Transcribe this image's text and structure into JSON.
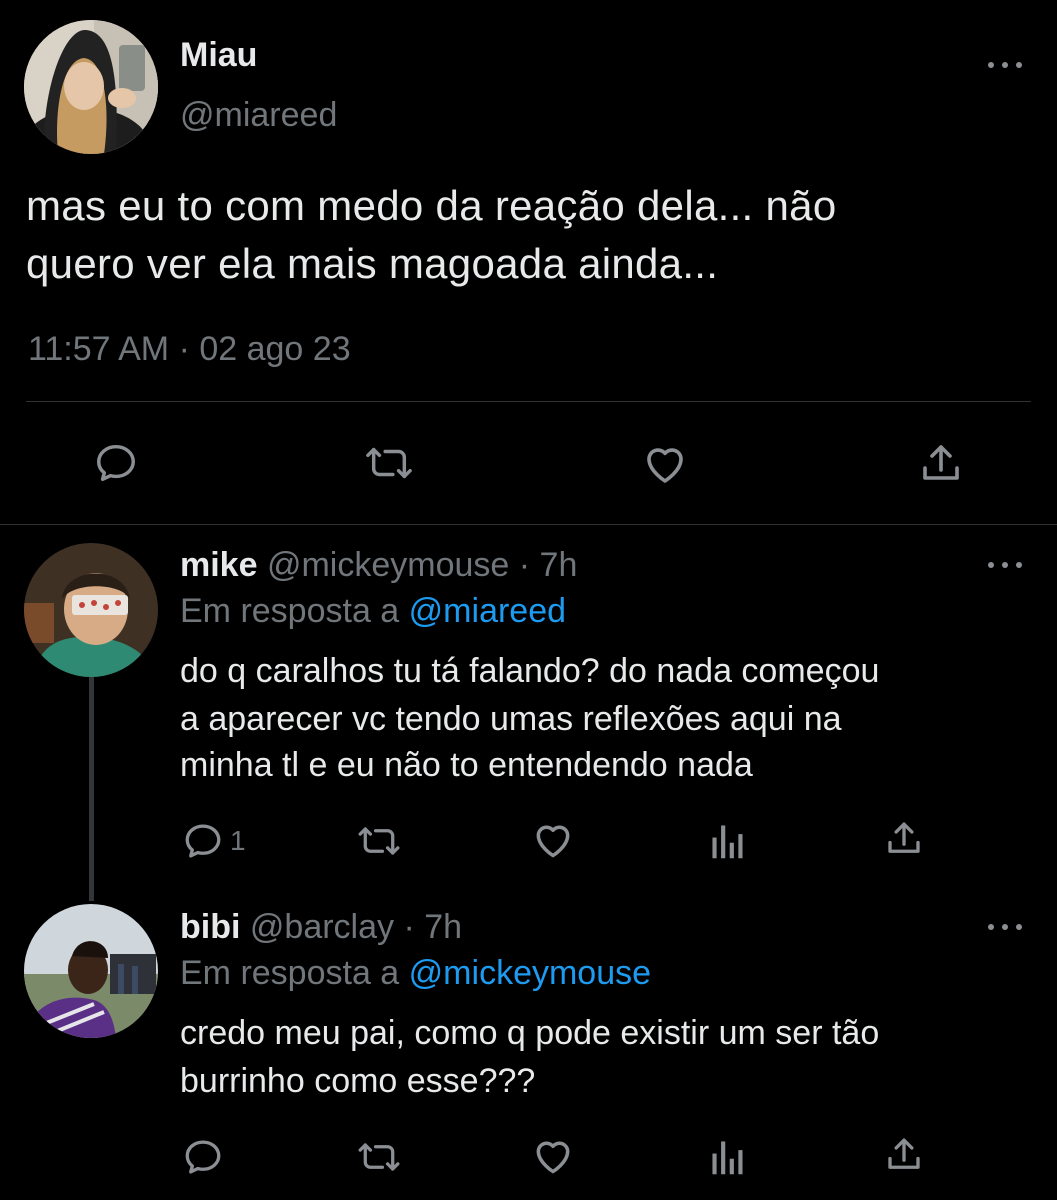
{
  "main_tweet": {
    "display_name": "Miau",
    "handle": "@miareed",
    "text_line1": "mas eu to com medo da reação dela... não",
    "text_line2": "quero ver ela mais magoada ainda...",
    "timestamp": "11:57 AM · 02 ago 23"
  },
  "replies": [
    {
      "display_name": "mike",
      "handle": "@mickeymouse",
      "time": "· 7h",
      "reply_prefix": "Em resposta a",
      "reply_to": "@miareed",
      "text_line1": "do q caralhos tu tá falando? do nada começou",
      "text_line2": "a aparecer vc tendo umas reflexões aqui na",
      "text_line3": "minha tl e eu não to entendendo nada",
      "reply_count": "1"
    },
    {
      "display_name": "bibi",
      "handle": "@barclay",
      "time": "· 7h",
      "reply_prefix": "Em resposta a",
      "reply_to": "@mickeymouse",
      "text_line1": "credo meu pai, como q pode existir um ser tão",
      "text_line2": "burrinho como esse???"
    }
  ],
  "icons": {
    "reply": "speech-bubble-icon",
    "retweet": "retweet-icon",
    "like": "heart-icon",
    "share": "share-upload-icon",
    "views": "bar-chart-icon",
    "more": "more-dots-icon"
  },
  "colors": {
    "background": "#000000",
    "text": "#e7e9ea",
    "muted": "#71767b",
    "link": "#1d9bf0"
  }
}
